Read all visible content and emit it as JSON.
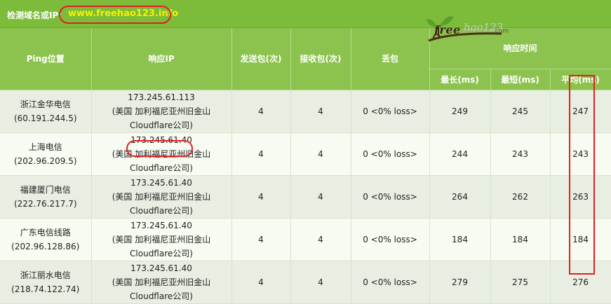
{
  "topbar": {
    "label": "检测域名或IP:",
    "domain": "www.freehao123.info"
  },
  "logo": {
    "word": "free",
    "number": "hao123",
    "suffix": ".com"
  },
  "table": {
    "headers": {
      "ping_location": "Ping位置",
      "response_ip": "响应IP",
      "sent": "发送包(次)",
      "received": "接收包(次)",
      "lost": "丢包",
      "response_time": "响应时间",
      "max": "最长(ms)",
      "min": "最短(ms)",
      "avg": "平均(ms)"
    },
    "rows": [
      {
        "location": "浙江金华电信",
        "location_ip": "(60.191.244.5)",
        "ip": "173.245.61.113",
        "ip_geo": "(美国 加利福尼亚州旧金山",
        "ip_org": "Cloudflare公司)",
        "sent": "4",
        "received": "4",
        "lost": "0 <0% loss>",
        "max": "249",
        "min": "245",
        "avg": "247"
      },
      {
        "location": "上海电信",
        "location_ip": "(202.96.209.5)",
        "ip": "173.245.61.40",
        "ip_geo": "(美国 加利福尼亚州旧金山",
        "ip_org": "Cloudflare公司)",
        "sent": "4",
        "received": "4",
        "lost": "0 <0% loss>",
        "max": "244",
        "min": "243",
        "avg": "243"
      },
      {
        "location": "福建厦门电信",
        "location_ip": "(222.76.217.7)",
        "ip": "173.245.61.40",
        "ip_geo": "(美国 加利福尼亚州旧金山",
        "ip_org": "Cloudflare公司)",
        "sent": "4",
        "received": "4",
        "lost": "0 <0% loss>",
        "max": "264",
        "min": "262",
        "avg": "263"
      },
      {
        "location": "广东电信线路",
        "location_ip": "(202.96.128.86)",
        "ip": "173.245.61.40",
        "ip_geo": "(美国 加利福尼亚州旧金山",
        "ip_org": "Cloudflare公司)",
        "sent": "4",
        "received": "4",
        "lost": "0 <0% loss>",
        "max": "184",
        "min": "184",
        "avg": "184"
      },
      {
        "location": "浙江丽水电信",
        "location_ip": "(218.74.122.74)",
        "ip": "173.245.61.40",
        "ip_geo": "(美国 加利福尼亚州旧金山",
        "ip_org": "Cloudflare公司)",
        "sent": "4",
        "received": "4",
        "lost": "0 <0% loss>",
        "max": "279",
        "min": "275",
        "avg": "276"
      }
    ]
  },
  "colors": {
    "header_green": "#8cc34e",
    "topbar_green": "#7cbc3a",
    "domain_yellow": "#f7f000",
    "highlight_red": "#e02020"
  }
}
